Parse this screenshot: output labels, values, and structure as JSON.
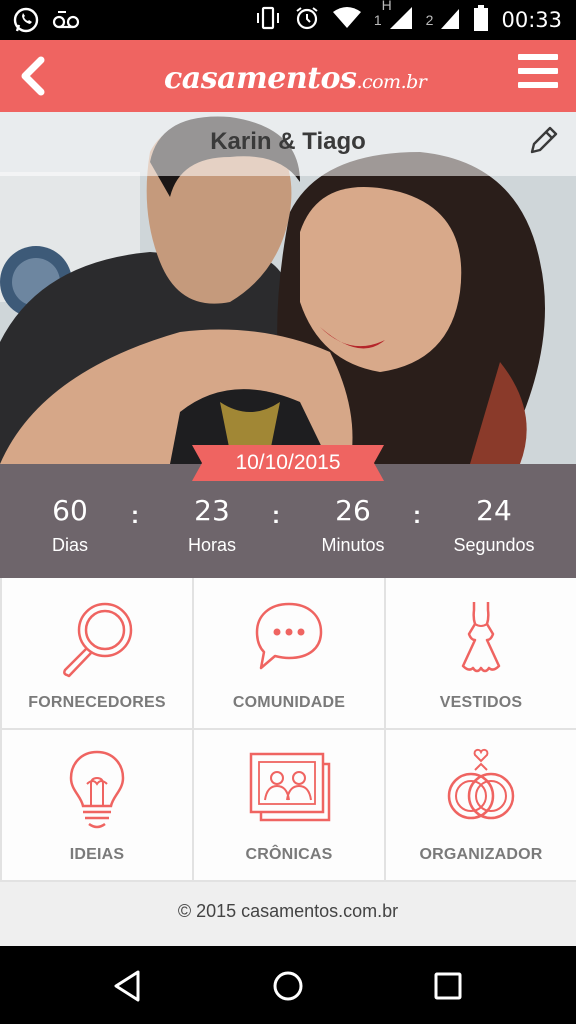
{
  "status_bar": {
    "time": "00:33",
    "signal_1_label": "1",
    "signal_2_label": "2",
    "network_type": "H",
    "icons": [
      "whatsapp-icon",
      "voicemail-icon",
      "vibrate-icon",
      "alarm-icon",
      "wifi-icon",
      "signal-icon",
      "battery-icon"
    ]
  },
  "header": {
    "logo_text": "casamentos",
    "logo_suffix": ".com.br",
    "brand_color": "#ef6461"
  },
  "profile": {
    "names": "Karin & Tiago",
    "wedding_date": "10/10/2015"
  },
  "countdown": {
    "days": "60",
    "days_label": "Dias",
    "hours": "23",
    "hours_label": "Horas",
    "minutes": "26",
    "minutes_label": "Minutos",
    "seconds": "24",
    "seconds_label": "Segundos",
    "separator": ":"
  },
  "menu_tiles": [
    {
      "label": "FORNECEDORES",
      "icon": "magnifier-icon"
    },
    {
      "label": "COMUNIDADE",
      "icon": "chat-bubble-icon"
    },
    {
      "label": "VESTIDOS",
      "icon": "dress-icon"
    },
    {
      "label": "IDEIAS",
      "icon": "lightbulb-icon"
    },
    {
      "label": "CRÔNICAS",
      "icon": "photo-album-icon"
    },
    {
      "label": "ORGANIZADOR",
      "icon": "rings-icon"
    }
  ],
  "footer": {
    "copyright": "© 2015 casamentos.com.br"
  },
  "accent_color": "#ef6461",
  "countdown_bg": "#6e656b"
}
